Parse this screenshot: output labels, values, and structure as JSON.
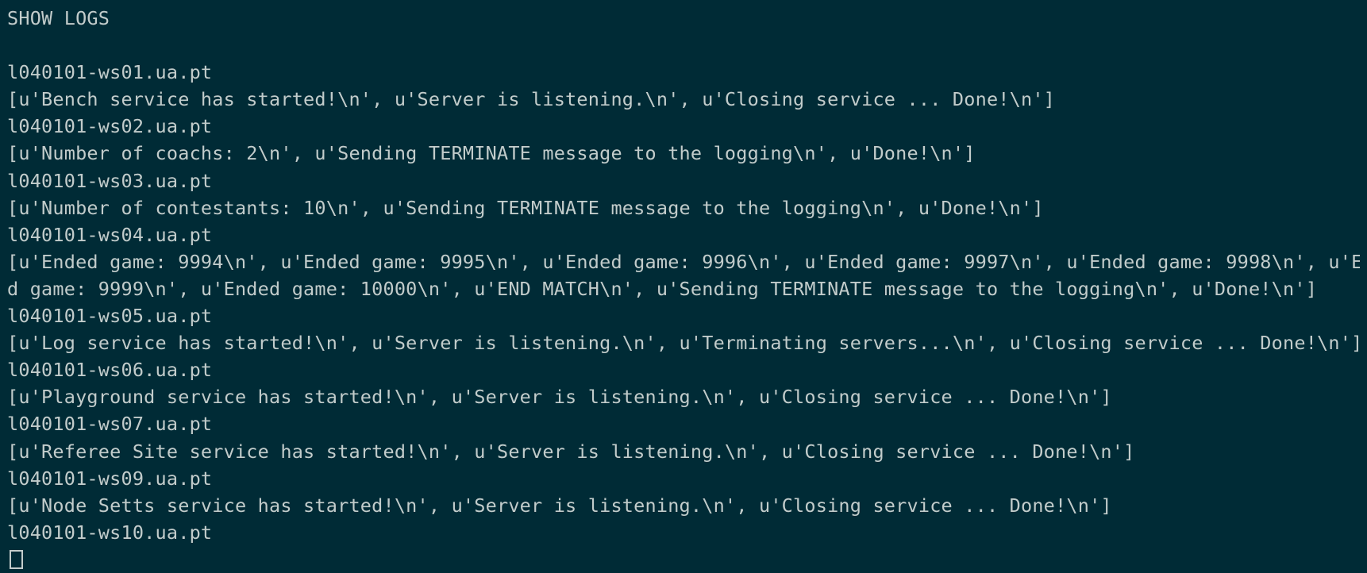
{
  "terminal": {
    "lines": [
      "SHOW LOGS",
      "",
      "l040101-ws01.ua.pt",
      "[u'Bench service has started!\\n', u'Server is listening.\\n', u'Closing service ... Done!\\n']",
      "l040101-ws02.ua.pt",
      "[u'Number of coachs: 2\\n', u'Sending TERMINATE message to the logging\\n', u'Done!\\n']",
      "l040101-ws03.ua.pt",
      "[u'Number of contestants: 10\\n', u'Sending TERMINATE message to the logging\\n', u'Done!\\n']",
      "l040101-ws04.ua.pt",
      "[u'Ended game: 9994\\n', u'Ended game: 9995\\n', u'Ended game: 9996\\n', u'Ended game: 9997\\n', u'Ended game: 9998\\n', u'Ende",
      "d game: 9999\\n', u'Ended game: 10000\\n', u'END MATCH\\n', u'Sending TERMINATE message to the logging\\n', u'Done!\\n']",
      "l040101-ws05.ua.pt",
      "[u'Log service has started!\\n', u'Server is listening.\\n', u'Terminating servers...\\n', u'Closing service ... Done!\\n']",
      "l040101-ws06.ua.pt",
      "[u'Playground service has started!\\n', u'Server is listening.\\n', u'Closing service ... Done!\\n']",
      "l040101-ws07.ua.pt",
      "[u'Referee Site service has started!\\n', u'Server is listening.\\n', u'Closing service ... Done!\\n']",
      "l040101-ws09.ua.pt",
      "[u'Node Setts service has started!\\n', u'Server is listening.\\n', u'Closing service ... Done!\\n']",
      "l040101-ws10.ua.pt"
    ]
  },
  "colors": {
    "background": "#002b36",
    "foreground": "#c2cccb"
  }
}
